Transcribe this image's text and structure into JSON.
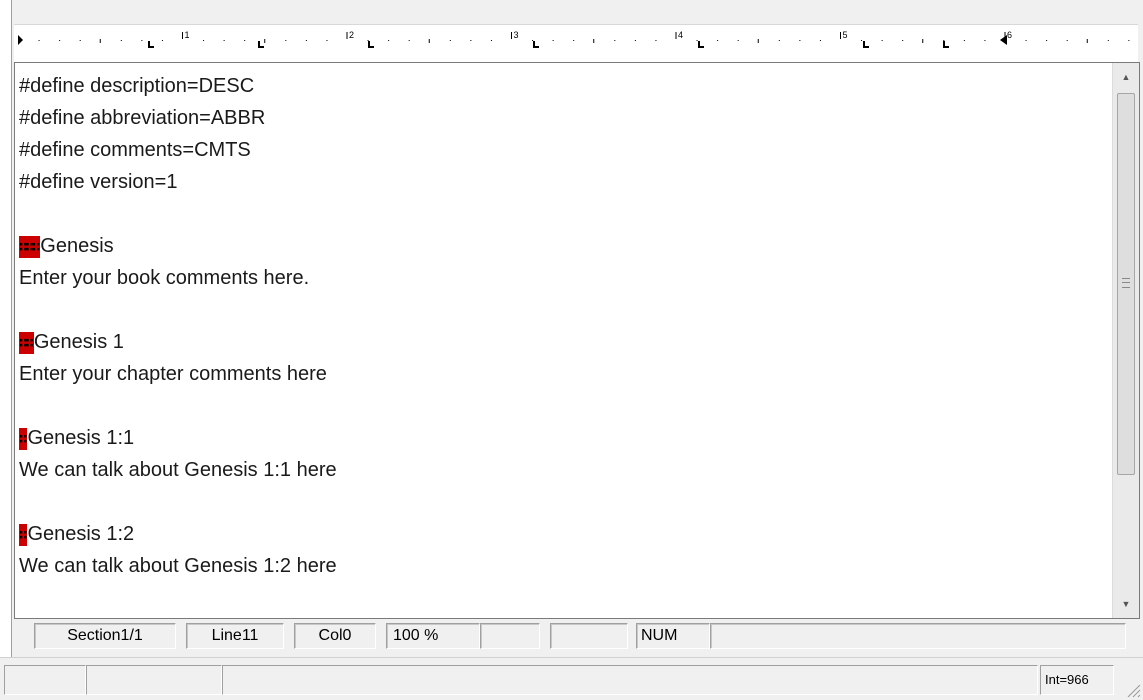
{
  "ruler": {
    "numbers": [
      "1",
      "2",
      "3",
      "4",
      "5",
      "6"
    ]
  },
  "document": {
    "lines": [
      {
        "marker": "",
        "text": "#define description=DESC"
      },
      {
        "marker": "",
        "text": "#define abbreviation=ABBR"
      },
      {
        "marker": "",
        "text": "#define comments=CMTS"
      },
      {
        "marker": "",
        "text": "#define version=1"
      },
      {
        "marker": "",
        "text": ""
      },
      {
        "marker": "∷∷∷",
        "text": "Genesis"
      },
      {
        "marker": "",
        "text": "Enter your book comments here."
      },
      {
        "marker": "",
        "text": ""
      },
      {
        "marker": "∷∷",
        "text": "Genesis 1"
      },
      {
        "marker": "",
        "text": "Enter your chapter comments here"
      },
      {
        "marker": "",
        "text": ""
      },
      {
        "marker": "∷",
        "text": "Genesis 1:1"
      },
      {
        "marker": "",
        "text": "We can talk about Genesis 1:1 here"
      },
      {
        "marker": "",
        "text": ""
      },
      {
        "marker": "∷",
        "text": "Genesis 1:2"
      },
      {
        "marker": "",
        "text": "We can talk about Genesis 1:2 here"
      }
    ]
  },
  "status": {
    "section": "Section1/1",
    "line": "Line11",
    "col": "Col0",
    "zoom": "100 %",
    "num": "NUM",
    "int": "Int=966"
  },
  "colors": {
    "marker": "#cc0000"
  }
}
